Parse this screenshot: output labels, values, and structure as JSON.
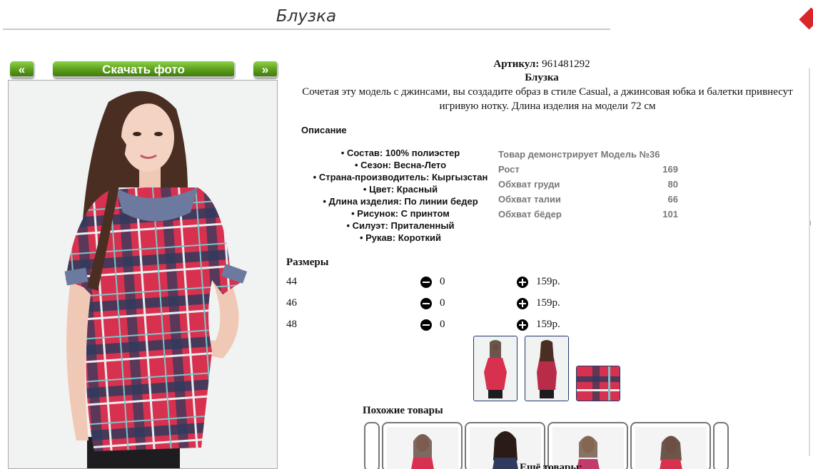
{
  "page": {
    "title": "Блузка"
  },
  "gallery": {
    "prev_label": "«",
    "download_label": "Скачать фото",
    "next_label": "»"
  },
  "product": {
    "article_label": "Артикул:",
    "article_value": "961481292",
    "name": "Блузка",
    "description": "Сочетая эту модель с джинсами, вы создадите образ в стиле Casual, а джинсовая юбка и балетки привнесут игривую нотку. Длина изделия на модели 72 см"
  },
  "description_heading": "Описание",
  "attributes": [
    "Состав: 100% полиэстер",
    "Сезон: Весна-Лето",
    "Страна-производитель: Кыргызстан",
    "Цвет: Красный",
    "Длина изделия: По линии бедер",
    "Рисунок: С принтом",
    "Силуэт: Приталенный",
    "Рукав: Короткий"
  ],
  "model": {
    "heading": "Товар демонстрирует Модель №36",
    "rows": [
      {
        "label": "Рост",
        "value": "169"
      },
      {
        "label": "Обхват груди",
        "value": "80"
      },
      {
        "label": "Обхват талии",
        "value": "66"
      },
      {
        "label": "Обхват бёдер",
        "value": "101"
      }
    ]
  },
  "sizes": {
    "heading": "Размеры",
    "rows": [
      {
        "size": "44",
        "qty": "0",
        "price": "159р."
      },
      {
        "size": "46",
        "qty": "0",
        "price": "159р."
      },
      {
        "size": "48",
        "qty": "0",
        "price": "159р."
      }
    ]
  },
  "similar_heading": "Похожие товары",
  "more_heading": "Ещё товары:",
  "colors": {
    "accent_green": "#5c9e1c",
    "thumb_border": "#1a3a6a",
    "shirt_red": "#d8314f",
    "shirt_navy": "#2f3a5c"
  },
  "icons": [
    "minus-circle-icon",
    "plus-circle-icon"
  ]
}
